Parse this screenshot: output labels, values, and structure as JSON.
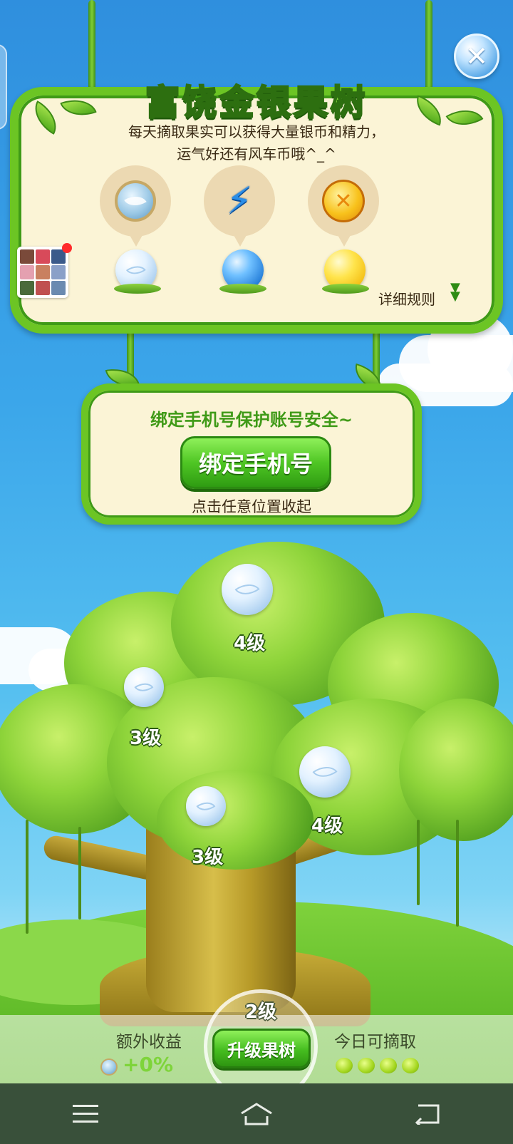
{
  "header": {
    "title": "富饶金银果树",
    "description_line1": "每天摘取果实可以获得大量银币和精力，",
    "description_line2": "运气好还有风车币哦^_^",
    "rules_link": "详细规则",
    "rewards": [
      {
        "icon": "silver-coin-icon"
      },
      {
        "icon": "energy-bolt-icon"
      },
      {
        "icon": "windmill-coin-icon"
      }
    ]
  },
  "bind_phone": {
    "message": "绑定手机号保护账号安全~",
    "button_label": "绑定手机号",
    "hint": "点击任意位置收起"
  },
  "tree_fruits": [
    {
      "level_label": "4级"
    },
    {
      "level_label": "3级"
    },
    {
      "level_label": "4级"
    },
    {
      "level_label": "3级"
    }
  ],
  "bottom": {
    "bonus_label": "额外收益",
    "bonus_value": "+0%",
    "tree_level": "2级",
    "upgrade_button": "升级果树",
    "pick_label": "今日可摘取",
    "pick_remaining": 4
  },
  "colors": {
    "accent_green": "#6cc524",
    "panel_bg": "#fbf4d6",
    "sky": "#3ba6ea"
  }
}
